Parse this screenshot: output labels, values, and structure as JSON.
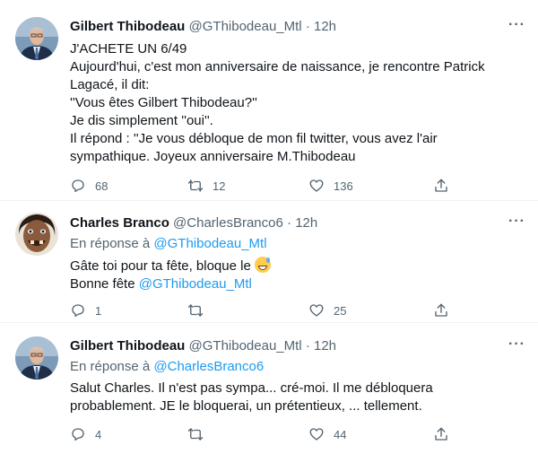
{
  "tweets": [
    {
      "name": "Gilbert Thibodeau",
      "handle": "@GThibodeau_Mtl",
      "dot": "·",
      "time": "12h",
      "more": "···",
      "lines": [
        "J'ACHETE UN 6/49",
        "Aujourd'hui, c'est mon anniversaire de naissance, je rencontre Patrick",
        "Lagacé, il dit:",
        "''Vous êtes Gilbert Thibodeau?''",
        "Je dis simplement  ''oui''.",
        "Il répond : ''Je vous débloque de mon fil twitter, vous avez l'air",
        "sympathique. Joyeux anniversaire M.Thibodeau"
      ],
      "replies": "68",
      "retweets": "12",
      "likes": "136"
    },
    {
      "name": "Charles Branco",
      "handle": "@CharlesBranco6",
      "dot": "·",
      "time": "12h",
      "more": "···",
      "reply_prefix": "En réponse à",
      "reply_to": "@GThibodeau_Mtl",
      "line1": "Gâte toi pour ta fête, bloque le",
      "line2_prefix": "Bonne fête",
      "line2_mention": "@GThibodeau_Mtl",
      "replies": "1",
      "retweets": "",
      "likes": "25"
    },
    {
      "name": "Gilbert Thibodeau",
      "handle": "@GThibodeau_Mtl",
      "dot": "·",
      "time": "12h",
      "more": "···",
      "reply_prefix": "En réponse à",
      "reply_to": "@CharlesBranco6",
      "lines": [
        "Salut Charles. Il n'est pas sympa... cré-moi. Il me débloquera",
        "probablement. JE le bloquerai, un prétentieux, ... tellement."
      ],
      "replies": "4",
      "retweets": "",
      "likes": "44"
    }
  ],
  "icons": {
    "reply": "reply-icon",
    "retweet": "retweet-icon",
    "like": "heart-icon",
    "share": "share-icon"
  },
  "colors": {
    "link": "#1d9bf0",
    "muted": "#536471",
    "text": "#0f1419"
  }
}
